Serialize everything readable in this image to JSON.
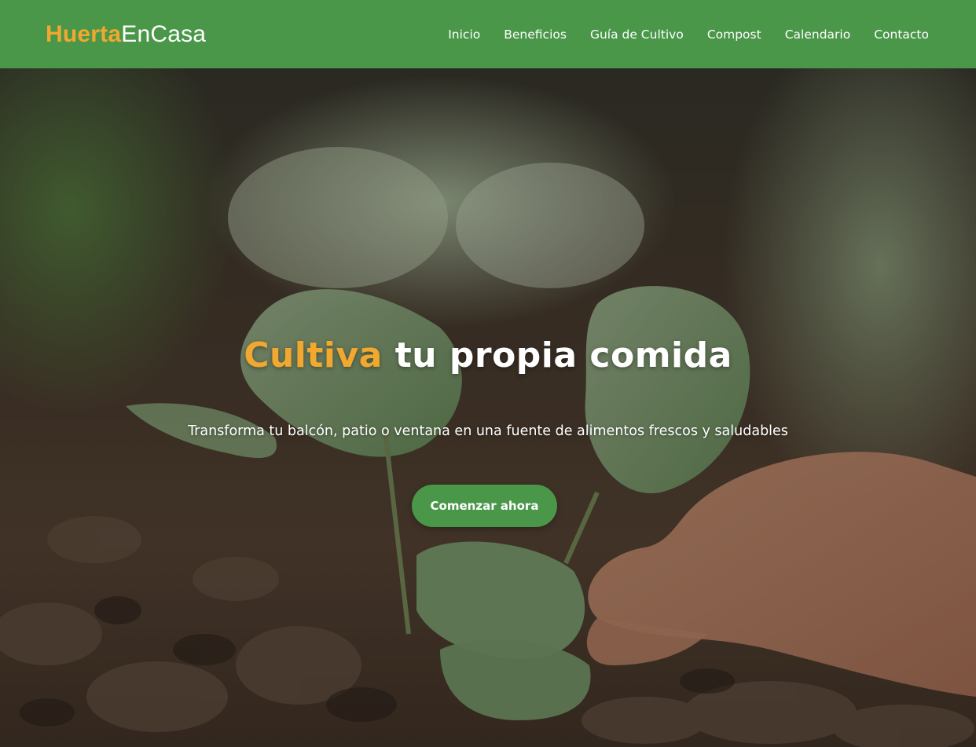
{
  "brand": {
    "logo_accent": "Huerta",
    "logo_rest": "EnCasa",
    "accent_color": "#f2a82e",
    "primary_color": "#4a974a"
  },
  "nav": {
    "items": [
      {
        "label": "Inicio"
      },
      {
        "label": "Beneficios"
      },
      {
        "label": "Guía de Cultivo"
      },
      {
        "label": "Compost"
      },
      {
        "label": "Calendario"
      },
      {
        "label": "Contacto"
      }
    ]
  },
  "hero": {
    "title_accent": "Cultiva",
    "title_rest": " tu propia comida",
    "subtitle": "Transforma tu balcón, patio o ventana en una fuente de alimentos frescos y saludables",
    "cta_label": "Comenzar ahora"
  }
}
